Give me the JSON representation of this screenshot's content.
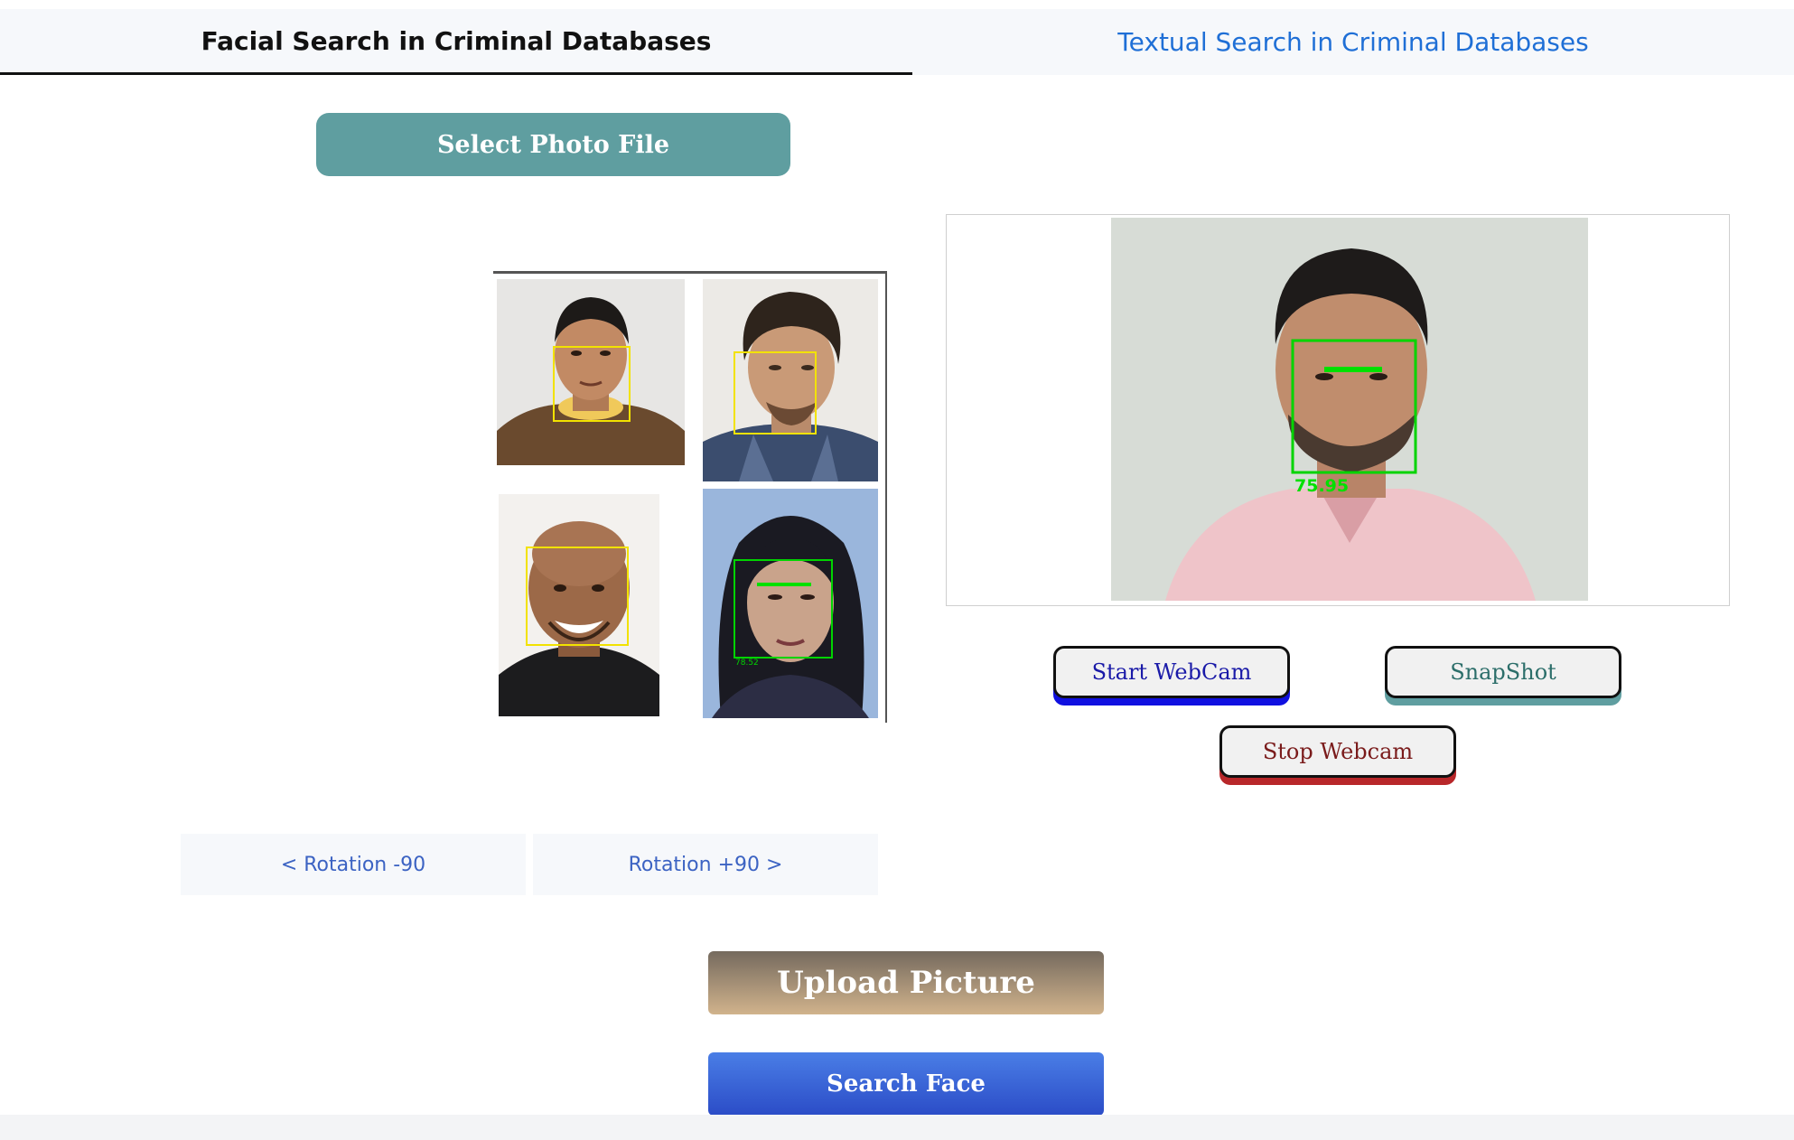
{
  "tabs": {
    "facial": "Facial Search in Criminal Databases",
    "textual": "Textual Search in Criminal Databases"
  },
  "buttons": {
    "select_photo": "Select Photo File",
    "start_webcam": "Start WebCam",
    "snapshot": "SnapShot",
    "stop_webcam": "Stop Webcam",
    "rotate_left": "< Rotation -90",
    "rotate_right": "Rotation +90 >",
    "upload": "Upload Picture",
    "search_face": "Search Face"
  },
  "preview": {
    "match_score": "75.95"
  },
  "collage": {
    "small_score": "78.52"
  }
}
